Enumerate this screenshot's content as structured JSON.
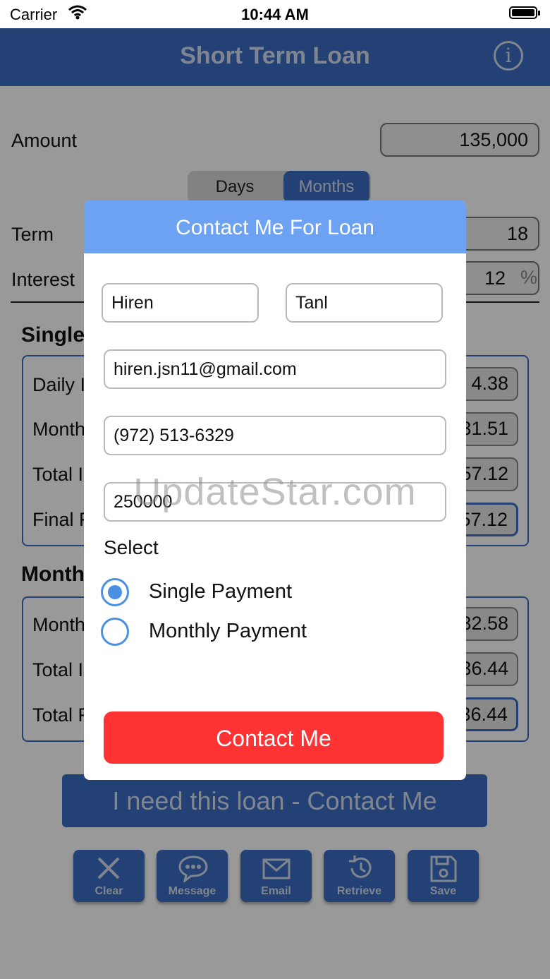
{
  "status_bar": {
    "carrier": "Carrier",
    "time": "10:44 AM"
  },
  "nav": {
    "title": "Short Term Loan"
  },
  "form": {
    "amount_label": "Amount",
    "amount_value": "135,000",
    "segment": {
      "options": [
        "Days",
        "Months"
      ],
      "selected": "Months"
    },
    "term_label": "Term",
    "term_value": "18",
    "interest_label": "Interest",
    "interest_value": "12",
    "interest_unit": "%"
  },
  "single_section": {
    "title": "Single",
    "rows": [
      {
        "label": "Daily I",
        "value": "4.38"
      },
      {
        "label": "Month",
        "value": "31.51"
      },
      {
        "label": "Total I",
        "value": "57.12"
      },
      {
        "label": "Final F",
        "value": "57.12"
      }
    ]
  },
  "monthly_section": {
    "title": "Month",
    "rows": [
      {
        "label": "Month",
        "value": "32.58"
      },
      {
        "label": "Total I",
        "value": "36.44"
      },
      {
        "label": "Total F",
        "value": "36.44"
      }
    ]
  },
  "big_button": {
    "label": "I need this loan - Contact Me"
  },
  "toolbar": {
    "clear": "Clear",
    "message": "Message",
    "email": "Email",
    "retrieve": "Retrieve",
    "save": "Save"
  },
  "modal": {
    "title": "Contact Me For Loan",
    "first_name": "Hiren",
    "last_name": "Tanl",
    "email": "hiren.jsn11@gmail.com",
    "phone": "(972) 513-6329",
    "amount": "250000",
    "select_label": "Select",
    "options": [
      "Single Payment",
      "Monthly Payment"
    ],
    "selected_option": "Single Payment",
    "submit_label": "Contact Me"
  },
  "watermark": "UpdateStar.com",
  "colors": {
    "nav": "#3b6dc3",
    "modal_header": "#6da2f2",
    "cta": "#ff3333",
    "radio": "#4a90e2"
  }
}
